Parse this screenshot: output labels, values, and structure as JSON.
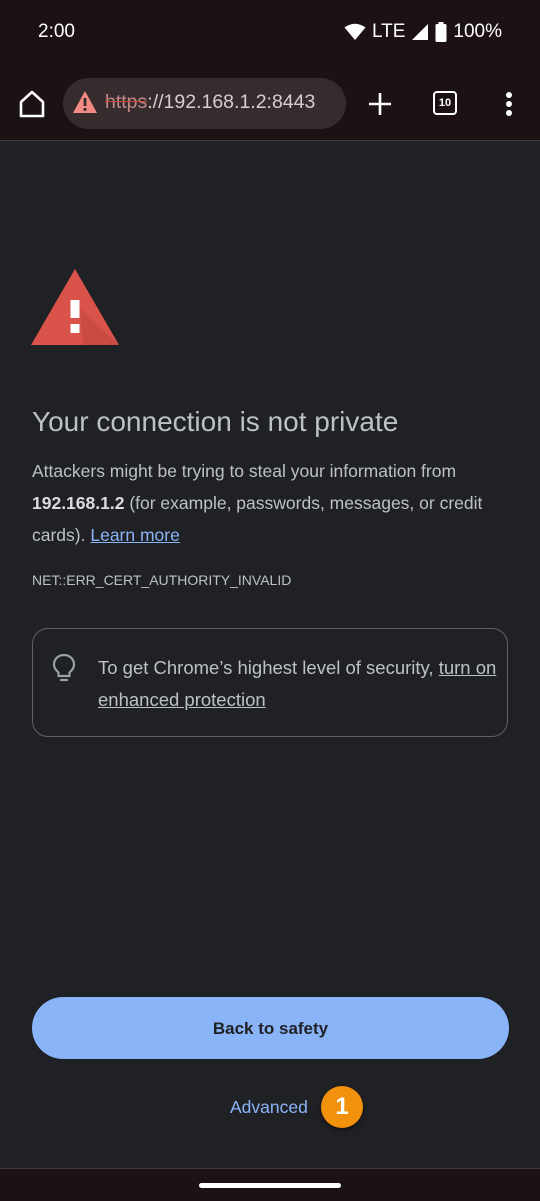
{
  "status_bar": {
    "time": "2:00",
    "network": "LTE",
    "battery": "100%"
  },
  "toolbar": {
    "url_scheme": "https",
    "url_rest": "://192.168.1.2:8443",
    "tab_count": "10",
    "icons": [
      "home-icon",
      "not-secure-warning-icon",
      "plus-icon",
      "tab-switcher-icon",
      "more-vert-icon"
    ]
  },
  "interstitial": {
    "heading": "Your connection is not private",
    "explanation_before": "Attackers might be trying to steal your information from ",
    "host": "192.168.1.2",
    "explanation_after": " (for example, passwords, messages, or credit cards). ",
    "learn_more": "Learn more",
    "error_code": "NET::ERR_CERT_AUTHORITY_INVALID",
    "protection_text": "To get Chrome’s highest level of security, ",
    "protection_link": "turn on enhanced protection",
    "back_button": "Back to safety",
    "advanced": "Advanced",
    "badge": "1"
  },
  "colors": {
    "background": "#202124",
    "accent": "#8ab4f8",
    "warning_red": "#d93025",
    "badge_orange": "#f2920c"
  }
}
